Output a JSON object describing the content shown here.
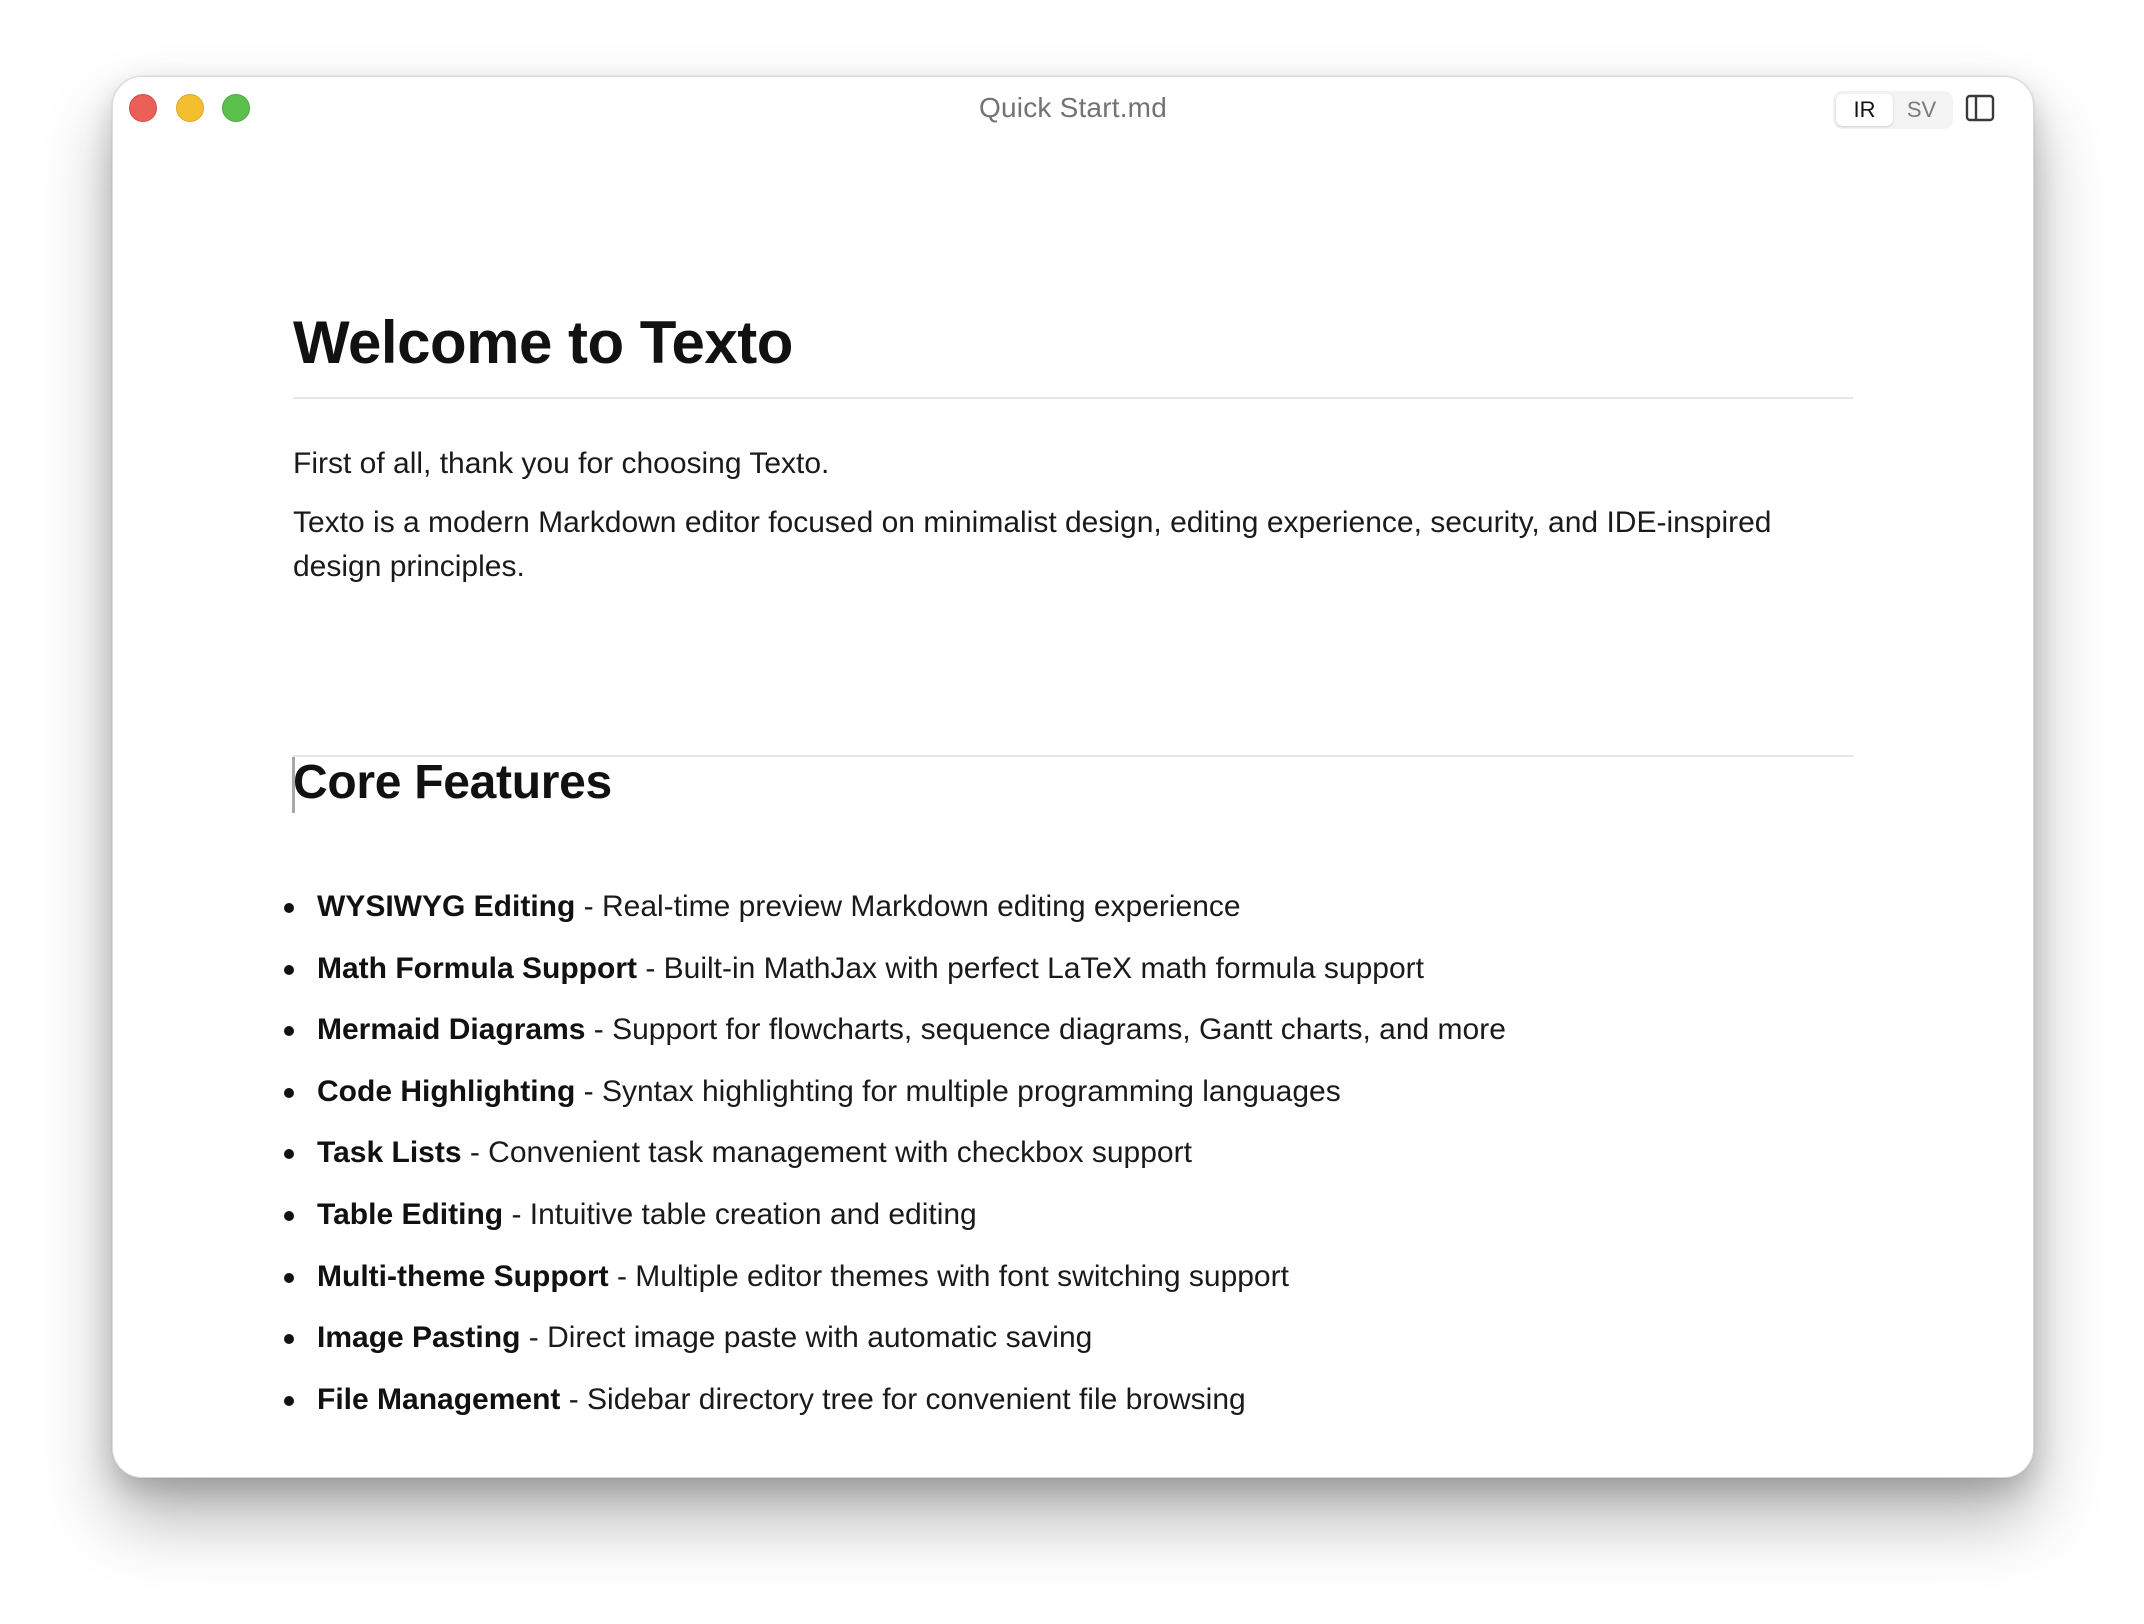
{
  "window": {
    "title": "Quick Start.md"
  },
  "toolbar": {
    "modes": [
      {
        "label": "IR",
        "active": true
      },
      {
        "label": "SV",
        "active": false
      }
    ],
    "sidebar_toggle_icon": "sidebar-panel-icon"
  },
  "document": {
    "heading1": "Welcome to Texto",
    "intro": "First of all, thank you for choosing Texto.",
    "description": "Texto is a modern Markdown editor focused on minimalist design, editing experience, security, and IDE-inspired design principles.",
    "heading2": "Core Features",
    "features": [
      {
        "name": "WYSIWYG Editing",
        "desc": " - Real-time preview Markdown editing experience"
      },
      {
        "name": "Math Formula Support",
        "desc": " - Built-in MathJax with perfect LaTeX math formula support"
      },
      {
        "name": "Mermaid Diagrams",
        "desc": " - Support for flowcharts, sequence diagrams, Gantt charts, and more"
      },
      {
        "name": "Code Highlighting",
        "desc": " - Syntax highlighting for multiple programming languages"
      },
      {
        "name": "Task Lists",
        "desc": " - Convenient task management with checkbox support"
      },
      {
        "name": "Table Editing",
        "desc": " - Intuitive table creation and editing"
      },
      {
        "name": "Multi-theme Support",
        "desc": " - Multiple editor themes with font switching support"
      },
      {
        "name": "Image Pasting",
        "desc": " - Direct image paste with automatic saving"
      },
      {
        "name": "File Management",
        "desc": " - Sidebar directory tree for convenient file browsing"
      }
    ]
  },
  "colors": {
    "close": "#ec5f59",
    "minimize": "#f4bf2f",
    "zoom": "#5cc04c",
    "text": "#1a1a1a",
    "rule": "#e6e6e6"
  }
}
